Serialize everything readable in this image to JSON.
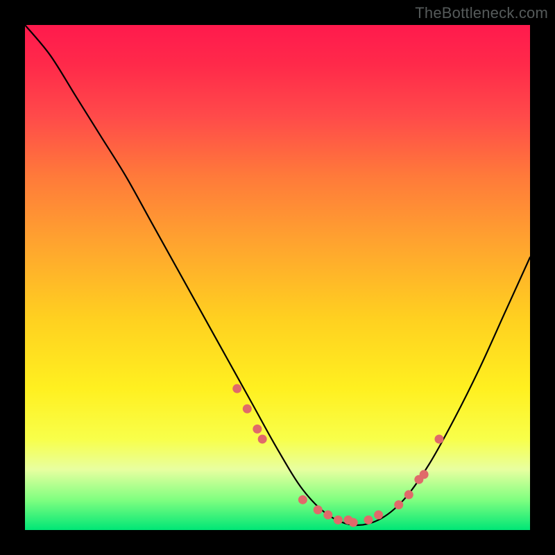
{
  "watermark": "TheBottleneck.com",
  "chart_data": {
    "type": "line",
    "title": "",
    "xlabel": "",
    "ylabel": "",
    "xlim": [
      0,
      100
    ],
    "ylim": [
      0,
      100
    ],
    "grid": false,
    "legend": false,
    "series": [
      {
        "name": "curve",
        "x": [
          0,
          5,
          10,
          15,
          20,
          25,
          30,
          35,
          40,
          45,
          50,
          55,
          60,
          65,
          70,
          75,
          80,
          85,
          90,
          95,
          100
        ],
        "y": [
          100,
          94,
          86,
          78,
          70,
          61,
          52,
          43,
          34,
          25,
          16,
          8,
          3,
          1,
          2,
          6,
          13,
          22,
          32,
          43,
          54
        ]
      }
    ],
    "markers": {
      "name": "highlighted-points",
      "color": "#e06a6a",
      "x": [
        42,
        44,
        46,
        47,
        55,
        58,
        60,
        62,
        64,
        65,
        68,
        70,
        74,
        76,
        78,
        79,
        82
      ],
      "y": [
        28,
        24,
        20,
        18,
        6,
        4,
        3,
        2,
        2,
        1.5,
        2,
        3,
        5,
        7,
        10,
        11,
        18
      ]
    }
  }
}
